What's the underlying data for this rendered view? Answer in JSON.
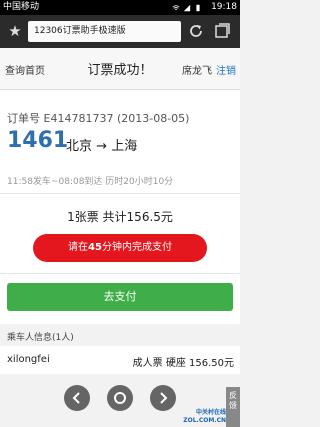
{
  "status_bar": {
    "carrier": "中国移动",
    "time": "19:18"
  },
  "browser": {
    "url": "12306订票助手极速版"
  },
  "nav": {
    "home": "查询首页",
    "title": "订票成功！",
    "user": "席龙飞",
    "logout": "注销"
  },
  "order": {
    "label": "订单号",
    "number": "E414781737",
    "date": "(2013-08-05)",
    "train": "1461",
    "from": "北京",
    "arrow": "→",
    "to": "上海",
    "timing": "11:58发车~08:08到达 历时20小时10分"
  },
  "summary": "1张票 共计156.5元",
  "pay_notice": {
    "pre": "请在",
    "minutes": "45",
    "post": "分钟内完成支付"
  },
  "pay_button": "去支付",
  "passengers": {
    "header": "乘车人信息(1人)",
    "rows": [
      {
        "name": "xilongfei",
        "info": "成人票 硬座 156.50元"
      }
    ]
  },
  "feedback": "反馈",
  "watermark": {
    "line1": "中关村在线",
    "line2": "ZOL.COM.CN"
  }
}
